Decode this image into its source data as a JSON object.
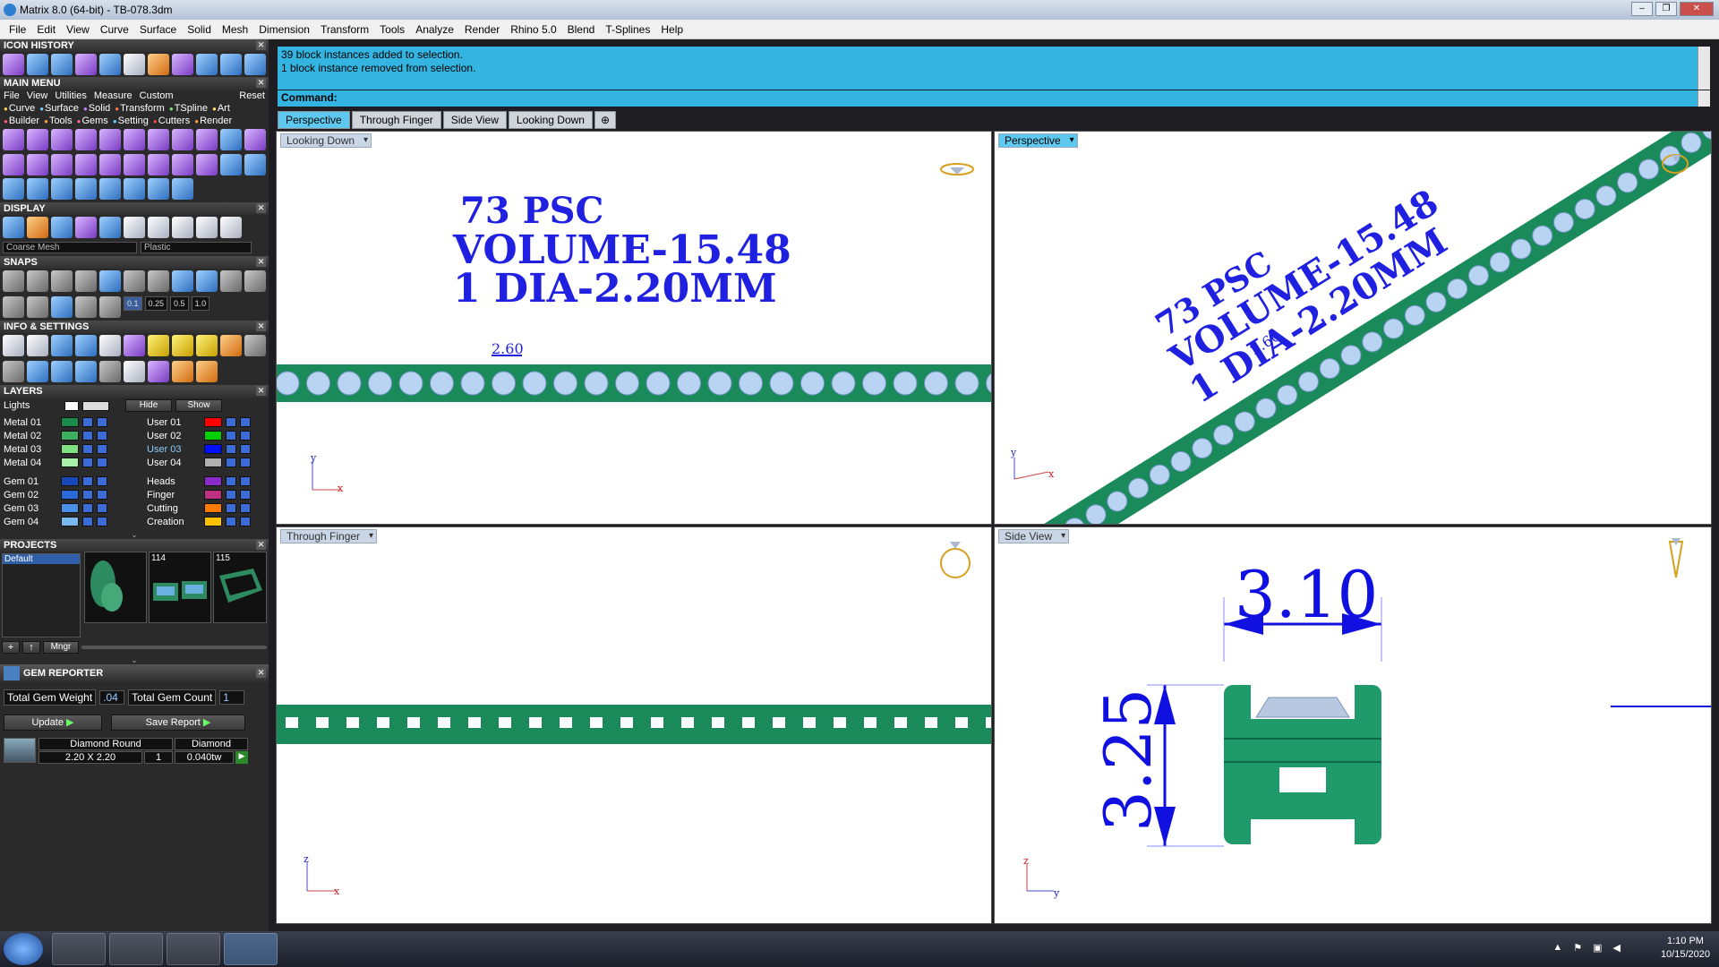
{
  "window": {
    "title": "Matrix 8.0 (64-bit) - TB-078.3dm"
  },
  "menubar": [
    "File",
    "Edit",
    "View",
    "Curve",
    "Surface",
    "Solid",
    "Mesh",
    "Dimension",
    "Transform",
    "Tools",
    "Analyze",
    "Render",
    "Rhino 5.0",
    "Blend",
    "T-Splines",
    "Help"
  ],
  "left_panel": {
    "icon_history": "ICON HISTORY",
    "main_menu": {
      "title": "MAIN MENU",
      "top_items": [
        "File",
        "View",
        "Utilities",
        "Measure",
        "Custom"
      ],
      "reset": "Reset",
      "row1": [
        "Curve",
        "Surface",
        "Solid",
        "Transform",
        "TSpline",
        "Art"
      ],
      "row2": [
        "Builder",
        "Tools",
        "Gems",
        "Setting",
        "Cutters",
        "Render"
      ]
    },
    "display": {
      "title": "DISPLAY",
      "mesh": "Coarse Mesh",
      "material": "Plastic"
    },
    "snaps": {
      "title": "SNAPS",
      "values": [
        "0.1",
        "0.25",
        "0.5",
        "1.0"
      ]
    },
    "info": "INFO & SETTINGS",
    "layers": {
      "title": "LAYERS",
      "lights": "Lights",
      "hide": "Hide",
      "show": "Show",
      "left": [
        {
          "name": "Metal 01",
          "color": "#1a8a4a"
        },
        {
          "name": "Metal 02",
          "color": "#3cb060"
        },
        {
          "name": "Metal 03",
          "color": "#7fe07f"
        },
        {
          "name": "Metal 04",
          "color": "#a8f0a8"
        },
        {
          "name": "Gem 01",
          "color": "#1848b8"
        },
        {
          "name": "Gem 02",
          "color": "#2a6ad8"
        },
        {
          "name": "Gem 03",
          "color": "#4a90e8"
        },
        {
          "name": "Gem 04",
          "color": "#7ab8f0"
        }
      ],
      "right": [
        {
          "name": "User 01",
          "color": "#ff0000"
        },
        {
          "name": "User 02",
          "color": "#00d000"
        },
        {
          "name": "User 03",
          "color": "#0010ff"
        },
        {
          "name": "User 04",
          "color": "#b0b0b0"
        },
        {
          "name": "Heads",
          "color": "#8a2ac8"
        },
        {
          "name": "Finger",
          "color": "#c03080"
        },
        {
          "name": "Cutting",
          "color": "#ff7a00"
        },
        {
          "name": "Creation",
          "color": "#ffc000"
        }
      ]
    },
    "projects": {
      "title": "PROJECTS",
      "default": "Default",
      "thumbs": [
        "",
        "114",
        "115"
      ],
      "mngr": "Mngr"
    },
    "gem_reporter": {
      "title": "GEM REPORTER",
      "weight_label": "Total Gem Weight",
      "weight_value": ".04",
      "count_label": "Total Gem Count",
      "count_value": "1",
      "update": "Update",
      "save": "Save Report",
      "gem": {
        "shape": "Diamond Round",
        "type": "Diamond",
        "size": "2.20 X 2.20",
        "qty": "1",
        "weight": "0.040tw"
      }
    }
  },
  "command": {
    "lines": [
      "39 block instances added to selection.",
      "1 block instance removed from selection."
    ],
    "prompt": "Command:"
  },
  "tabs": [
    "Perspective",
    "Through Finger",
    "Side View",
    "Looking Down"
  ],
  "viewports": {
    "top_left": {
      "label": "Looking Down",
      "text1": "73 PSC",
      "text2": "VOLUME-15.48",
      "text3": "1 DIA-2.20MM",
      "dim": "2.60"
    },
    "top_right": {
      "label": "Perspective",
      "text1": "73 PSC",
      "text2": "VOLUME-15.48",
      "text3": "1 DIA-2.20MM",
      "dim": "2.60"
    },
    "bottom_left": {
      "label": "Through Finger"
    },
    "bottom_right": {
      "label": "Side View",
      "width": "3.10",
      "height": "3.25"
    }
  },
  "clock": {
    "time": "1:10 PM",
    "date": "10/15/2020"
  }
}
